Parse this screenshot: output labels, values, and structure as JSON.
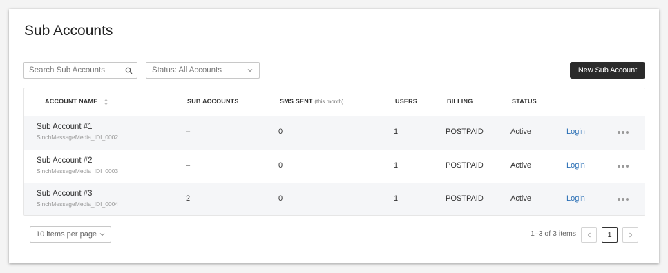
{
  "page": {
    "title": "Sub Accounts"
  },
  "toolbar": {
    "search_placeholder": "Search Sub Accounts",
    "status_filter": "Status: All Accounts",
    "new_button": "New Sub Account"
  },
  "table": {
    "headers": {
      "account_name": "ACCOUNT NAME",
      "sub_accounts": "SUB ACCOUNTS",
      "sms_sent": "SMS SENT",
      "sms_sent_sub": "(this month)",
      "users": "USERS",
      "billing": "BILLING",
      "status": "STATUS"
    },
    "rows": [
      {
        "name": "Sub Account #1",
        "id": "SinchMessageMedia_IDI_0002",
        "sub_accounts": "–",
        "sms_sent": "0",
        "users": "1",
        "billing": "POSTPAID",
        "status": "Active",
        "action": "Login"
      },
      {
        "name": "Sub Account #2",
        "id": "SinchMessageMedia_IDI_0003",
        "sub_accounts": "–",
        "sms_sent": "0",
        "users": "1",
        "billing": "POSTPAID",
        "status": "Active",
        "action": "Login"
      },
      {
        "name": "Sub Account #3",
        "id": "SinchMessageMedia_IDI_0004",
        "sub_accounts": "2",
        "sms_sent": "0",
        "users": "1",
        "billing": "POSTPAID",
        "status": "Active",
        "action": "Login"
      }
    ]
  },
  "pagination": {
    "per_page": "10 items per page",
    "range": "1–3 of 3 items",
    "current_page": "1"
  },
  "colors": {
    "primary_button": "#2b2b2b",
    "link": "#2a6fb5",
    "row_shade": "#f5f6f8"
  },
  "icons": [
    "search-icon",
    "chevron-down-icon",
    "sort-icon",
    "more-icon",
    "chevron-left-icon",
    "chevron-right-icon"
  ]
}
